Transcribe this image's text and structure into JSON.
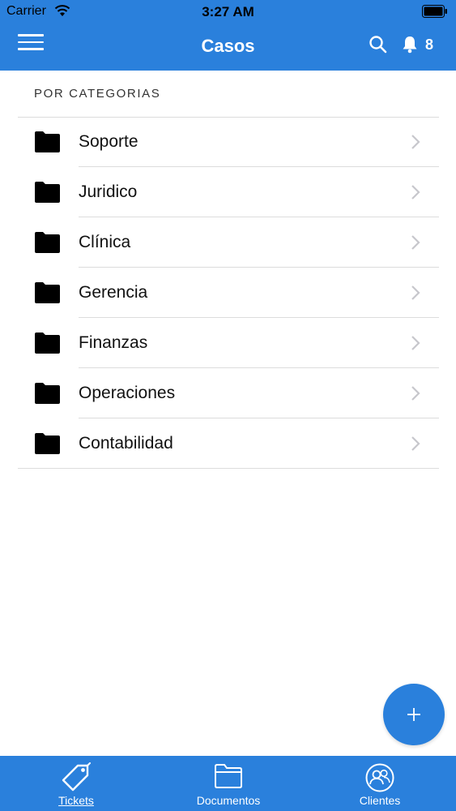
{
  "status_bar": {
    "carrier": "Carrier",
    "time": "3:27 AM"
  },
  "nav": {
    "title": "Casos",
    "notification_count": "8"
  },
  "section": {
    "header": "POR CATEGORIAS"
  },
  "categories": [
    {
      "label": "Soporte"
    },
    {
      "label": "Juridico"
    },
    {
      "label": "Clínica"
    },
    {
      "label": "Gerencia"
    },
    {
      "label": "Finanzas"
    },
    {
      "label": "Operaciones"
    },
    {
      "label": "Contabilidad"
    }
  ],
  "tabs": [
    {
      "label": "Tickets",
      "icon": "tag-icon",
      "active": true
    },
    {
      "label": "Documentos",
      "icon": "folder-outline-icon",
      "active": false
    },
    {
      "label": "Clientes",
      "icon": "users-icon",
      "active": false
    }
  ],
  "colors": {
    "primary": "#2a80dc",
    "divider": "#dcdcdc",
    "text": "#111111"
  }
}
